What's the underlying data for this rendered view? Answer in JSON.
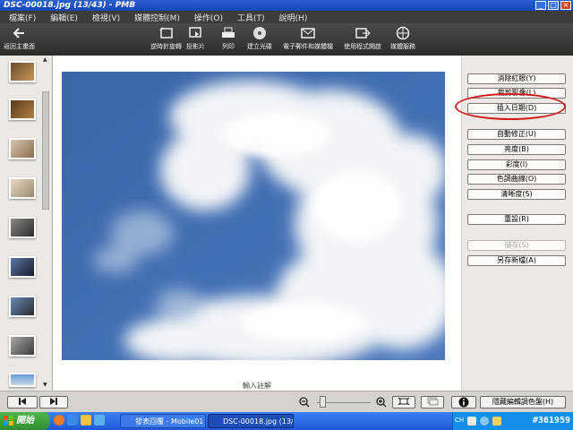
{
  "window": {
    "title": "DSC-00018.jpg (13/43) - PMB"
  },
  "menu": [
    "檔案(F)",
    "編輯(E)",
    "檢視(V)",
    "媒體控制(M)",
    "操作(O)",
    "工具(T)",
    "說明(H)"
  ],
  "toolbar": {
    "back": "返回主畫面",
    "rotate": "逆時針旋轉",
    "slideshow": "投影片",
    "print": "列印",
    "burn": "建立光碟",
    "email": "電子郵件和媒體檔",
    "open_with": "使用程式開啟",
    "web": "媒體服務"
  },
  "panel": {
    "redeye": "消除紅眼(Y)",
    "crop": "裁剪影像(L)",
    "insert_date": "插入日期(D)",
    "auto_correct": "自動修正(U)",
    "brightness": "亮度(B)",
    "saturation": "彩度(I)",
    "tone_curve": "色調曲線(O)",
    "sharpness": "清晰度(S)",
    "reset": "重設(R)",
    "save": "儲存(S)",
    "save_as": "另存新檔(A)"
  },
  "caption": "輸入註解",
  "bottom": {
    "hide_viewer": "隱藏編輯調色盤(H)",
    "zoom_level": 0.05
  },
  "taskbar": {
    "start": "開始",
    "task1": "發表回覆 - Mobile01 ...",
    "task2": "DSC-00018.jpg (13/4...",
    "clock": "#361959",
    "tray_text": "CH"
  },
  "colors": {
    "highlight": "#d21a1a",
    "title_blue": "#1747b8",
    "sky": "#3e6bb0"
  }
}
